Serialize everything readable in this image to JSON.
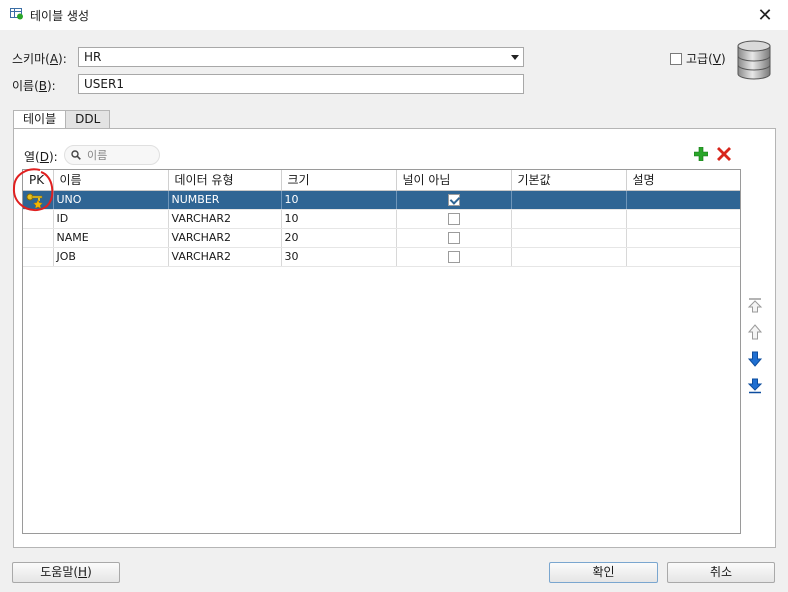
{
  "window": {
    "title": "테이블 생성",
    "close_glyph": "✕"
  },
  "form": {
    "schema_label": "스키마(",
    "schema_mnemonic": "A",
    "schema_label_end": "):",
    "schema_value": "HR",
    "name_label": "이름(",
    "name_mnemonic": "B",
    "name_label_end": "):",
    "name_value": "USER1",
    "advanced_label": "고급(",
    "advanced_mnemonic": "V",
    "advanced_label_end": ")",
    "advanced_checked": false
  },
  "tabs": [
    {
      "label": "테이블",
      "active": true
    },
    {
      "label": "DDL",
      "active": false
    }
  ],
  "columns_panel": {
    "label": "열(",
    "mnemonic": "D",
    "label_end": "):",
    "search_placeholder": "이름",
    "headers": [
      "PK",
      "이름",
      "데이터 유형",
      "크기",
      "널이 아님",
      "기본값",
      "설명"
    ],
    "rows": [
      {
        "pk": true,
        "name": "UNO",
        "type": "NUMBER",
        "size": "10",
        "not_null": true,
        "default": "",
        "comment": "",
        "selected": true
      },
      {
        "pk": false,
        "name": "ID",
        "type": "VARCHAR2",
        "size": "10",
        "not_null": false,
        "default": "",
        "comment": "",
        "selected": false
      },
      {
        "pk": false,
        "name": "NAME",
        "type": "VARCHAR2",
        "size": "20",
        "not_null": false,
        "default": "",
        "comment": "",
        "selected": false
      },
      {
        "pk": false,
        "name": "JOB",
        "type": "VARCHAR2",
        "size": "30",
        "not_null": false,
        "default": "",
        "comment": "",
        "selected": false
      }
    ],
    "icons": [
      "add-column-icon",
      "delete-column-icon",
      "move-top-icon",
      "move-up-icon",
      "move-down-icon",
      "move-bottom-icon"
    ]
  },
  "buttons": {
    "help_label": "도움말(",
    "help_mnemonic": "H",
    "help_label_end": ")",
    "ok_label": "확인",
    "cancel_label": "취소"
  },
  "colors": {
    "selection": "#2f6594",
    "add_icon": "#2aa52a",
    "delete_icon": "#d8261c",
    "arrow_icon": "#1f6fd1",
    "annotation_circle": "#e02020"
  }
}
